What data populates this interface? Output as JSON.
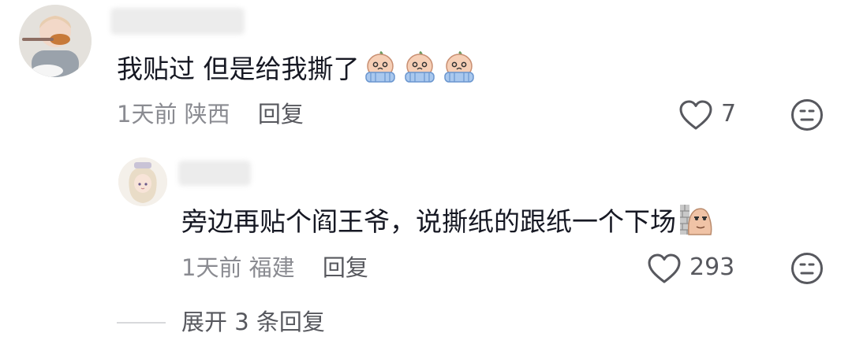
{
  "comment": {
    "text": "我贴过 但是给我撕了",
    "emojis": [
      "crying-face-emoji",
      "crying-face-emoji",
      "crying-face-emoji"
    ],
    "time": "1天前",
    "location": "陕西",
    "reply_label": "回复",
    "likes": "7"
  },
  "reply": {
    "text": "旁边再贴个阎王爷，说撕纸的跟纸一个下场",
    "emoji": "peeking-face-emoji",
    "time": "1天前",
    "location": "福建",
    "reply_label": "回复",
    "likes": "293"
  },
  "expand": {
    "label": "展开 3 条回复"
  }
}
